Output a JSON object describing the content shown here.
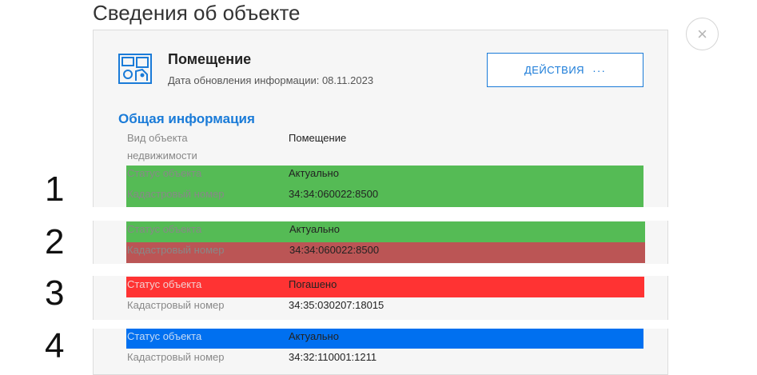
{
  "page": {
    "title": "Сведения об объекте",
    "close_glyph": "×"
  },
  "object": {
    "icon": "room-plan-icon",
    "name": "Помещение",
    "update_date": "Дата обновления информации: 08.11.2023"
  },
  "actions": {
    "label": "ДЕЙСТВИЯ",
    "more_glyph": "···"
  },
  "section": {
    "title": "Общая информация",
    "type_label_1": "Вид объекта",
    "type_label_2": "недвижимости",
    "type_value": "Помещение"
  },
  "variants": [
    {
      "number": "1",
      "status_label": "Статус объекта",
      "status_value": "Актуально",
      "cadastral_label": "Кадастровый номер",
      "cadastral_value": "34:34:060022:8500",
      "colors": {
        "status_row": "#55bb55",
        "cadastral_row": "#55bb55"
      }
    },
    {
      "number": "2",
      "status_label": "Статус объекта",
      "status_value": "Актуально",
      "cadastral_label": "Кадастровый номер",
      "cadastral_value": "34:34:060022:8500",
      "colors": {
        "status_row": "#55bb55",
        "cadastral_row": "#bb5555"
      }
    },
    {
      "number": "3",
      "status_label": "Статус объекта",
      "status_value": "Погашено",
      "cadastral_label": "Кадастровый номер",
      "cadastral_value": "34:35:030207:18015",
      "colors": {
        "status_row": "#ff3333",
        "cadastral_row": "none"
      }
    },
    {
      "number": "4",
      "status_label": "Статус объекта",
      "status_value": "Актуально",
      "cadastral_label": "Кадастровый номер",
      "cadastral_value": "34:32:110001:1211",
      "colors": {
        "status_row": "#0070f0",
        "cadastral_row": "none"
      }
    }
  ],
  "colors": {
    "accent": "#1a7bd8",
    "panel": "#f6f6f6"
  }
}
